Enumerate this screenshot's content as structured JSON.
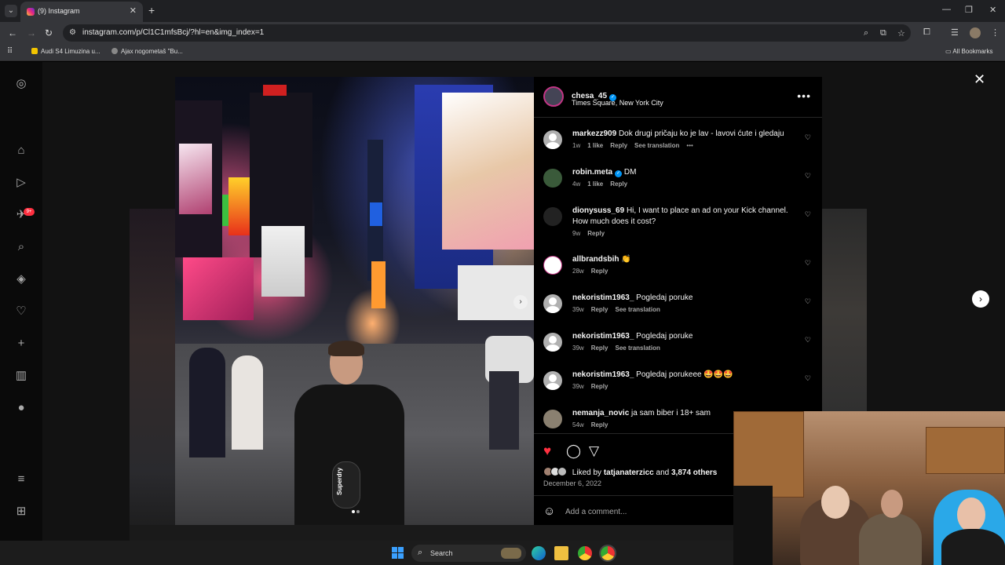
{
  "browser": {
    "tab_title": "(9) Instagram",
    "url": "instagram.com/p/Cl1C1mfsBcj/?hl=en&img_index=1",
    "bookmarks": [
      {
        "label": "Audi S4 Limuzina u...",
        "color": "#f2c400"
      },
      {
        "label": "Ajax nogometaš \"Bu...",
        "color": "#888888"
      }
    ],
    "all_bookmarks": "All Bookmarks"
  },
  "post": {
    "username": "chesa_45",
    "location": "Times Square, New York City",
    "bag_text": "Superdry",
    "comments": [
      {
        "user": "markezz909",
        "text": "Dok drugi pričaju ko je lav - lavovi ćute i gledaju",
        "time": "1w",
        "likes": "1 like",
        "reply": "Reply",
        "translate": "See translation",
        "extra": "•••",
        "verified": false
      },
      {
        "user": "robin.meta",
        "text": "DM",
        "time": "4w",
        "likes": "1 like",
        "reply": "Reply",
        "translate": "",
        "extra": "",
        "verified": true
      },
      {
        "user": "dionysuss_69",
        "text": "Hi, I want to place an ad on your Kick channel. How much does it cost?",
        "time": "9w",
        "likes": "",
        "reply": "Reply",
        "translate": "",
        "extra": "",
        "verified": false
      },
      {
        "user": "allbrandsbih",
        "text": "👏",
        "time": "28w",
        "likes": "",
        "reply": "Reply",
        "translate": "",
        "extra": "",
        "verified": false
      },
      {
        "user": "nekoristim1963_",
        "text": "Pogledaj poruke",
        "time": "39w",
        "likes": "",
        "reply": "Reply",
        "translate": "See translation",
        "extra": "",
        "verified": false
      },
      {
        "user": "nekoristim1963_",
        "text": "Pogledaj poruke",
        "time": "39w",
        "likes": "",
        "reply": "Reply",
        "translate": "See translation",
        "extra": "",
        "verified": false
      },
      {
        "user": "nekoristim1963_",
        "text": "Pogledaj porukeee 🤩🤩🤩",
        "time": "39w",
        "likes": "",
        "reply": "Reply",
        "translate": "",
        "extra": "",
        "verified": false
      },
      {
        "user": "nemanja_novic",
        "text": "ja sam biber i 18+ sam",
        "time": "54w",
        "likes": "",
        "reply": "Reply",
        "translate": "",
        "extra": "",
        "verified": false
      }
    ],
    "liked_by_prefix": "Liked by",
    "liked_by_user": "tatjanaterzicc",
    "liked_by_and": "and",
    "liked_by_others": "3,874 others",
    "date": "December 6, 2022",
    "add_comment_placeholder": "Add a comment..."
  },
  "sidebar_badge": "9+",
  "taskbar": {
    "search_label": "Search"
  },
  "colors": {
    "like_red": "#ff3040",
    "verified_blue": "#0095f6",
    "background": "#121212"
  }
}
